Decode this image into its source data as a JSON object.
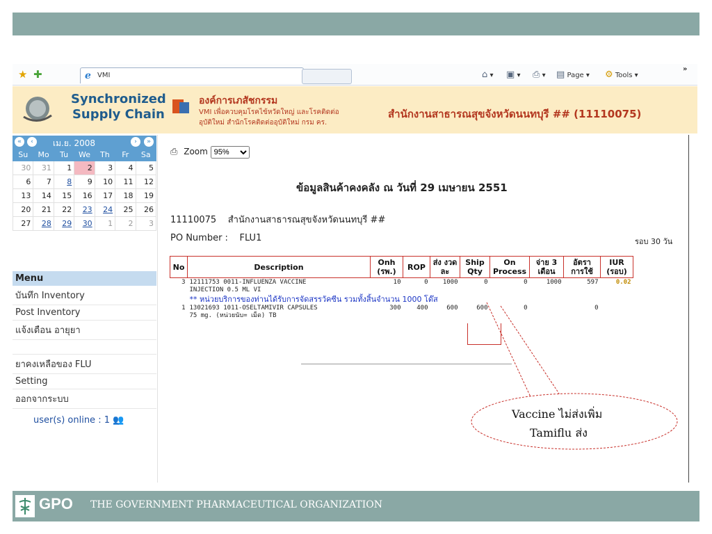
{
  "browser": {
    "tab_title": "VMI",
    "page_menu": "Page",
    "tools_menu": "Tools"
  },
  "header": {
    "brand_line1": "Synchronized",
    "brand_line2": "Supply Chain",
    "org_name": "องค์การเภสัชกรรม",
    "org_sub1": "VMI เพื่อควบคุมโรคไข้หวัดใหญ่ และโรคติดต่อ",
    "org_sub2": "อุบัติใหม่ สำนักโรคติดต่ออุบัติใหม่ กรม คร.",
    "office": "สำนักงานสาธารณสุขจังหวัดนนทบุรี ## (11110075)"
  },
  "calendar": {
    "month": "เม.ย. 2008",
    "dow": [
      "Su",
      "Mo",
      "Tu",
      "We",
      "Th",
      "Fr",
      "Sa"
    ],
    "weeks": [
      [
        "30",
        "31",
        "1",
        "2",
        "3",
        "4",
        "5"
      ],
      [
        "6",
        "7",
        "8",
        "9",
        "10",
        "11",
        "12"
      ],
      [
        "13",
        "14",
        "15",
        "16",
        "17",
        "18",
        "19"
      ],
      [
        "20",
        "21",
        "22",
        "23",
        "24",
        "25",
        "26"
      ],
      [
        "27",
        "28",
        "29",
        "30",
        "1",
        "2",
        "3"
      ]
    ]
  },
  "menu": {
    "title": "Menu",
    "items": [
      "บันทึก Inventory",
      "Post Inventory",
      "แจ้งเตือน อายุยา",
      "ยาคงเหลือของ FLU",
      "Setting",
      "ออกจากระบบ"
    ],
    "online": "user(s) online : 1"
  },
  "report": {
    "zoom_label": "Zoom",
    "zoom_value": "95%",
    "title": "ข้อมูลสินค้าคงคลัง ณ วันที่  29 เมษายน 2551",
    "office_code": "11110075",
    "office_name": "สำนักงานสาธารณสุขจังหวัดนนทบุรี ##",
    "po_label": "PO Number :",
    "po_value": "FLU1",
    "cycle": "รอบ 30 วัน",
    "columns": [
      "No",
      "Description",
      "Onh (รพ.)",
      "ROP",
      "ส่ง งวดละ",
      "Ship Qty",
      "On Process",
      "จ่าย 3 เดือน",
      "อัตรา การใช้",
      "IUR (รอบ)"
    ],
    "rows": [
      {
        "no": "3",
        "desc1": "12111753 0011-INFLUENZA VACCINE",
        "desc2": "INJECTION 0.5 ML VI",
        "onh": "10",
        "rop": "0",
        "lot": "1000",
        "ship": "0",
        "onproc": "0",
        "pay3": "1000",
        "rate": "597",
        "iur": "0.02"
      },
      {
        "no": "1",
        "desc1": "13021693 1011-OSELTAMIVIR CAPSULES",
        "desc2": "75 mg. (หน่วยนับ= เม็ด) TB",
        "onh": "300",
        "rop": "400",
        "lot": "600",
        "ship": "600",
        "onproc": "0",
        "pay3": "",
        "rate": "0",
        "iur": ""
      }
    ],
    "note": "** หน่วยบริการของท่านได้รับการจัดสรรวัคซีน รวมทั้งสิ้นจำนวน 1000 โด๊ส"
  },
  "callout": {
    "line1": "Vaccine ไม่ส่งเพิ่ม",
    "line2": "Tamiflu ส่ง"
  },
  "footer": {
    "logo": "GPO",
    "org": "THE GOVERNMENT PHARMACEUTICAL ORGANIZATION"
  }
}
